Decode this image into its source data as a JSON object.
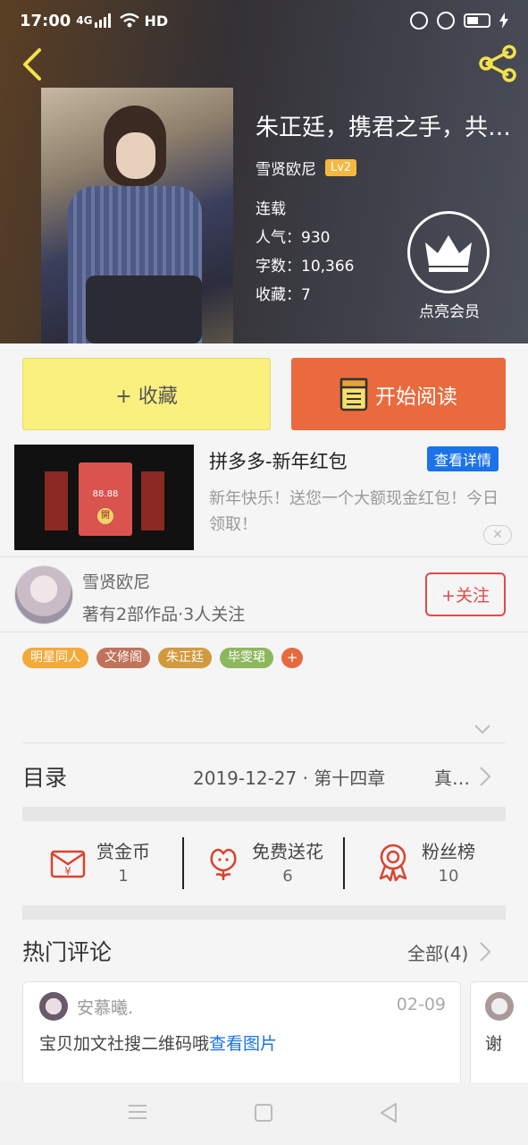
{
  "status_bar": {
    "time": "17:00",
    "network": "4G",
    "quality": "HD"
  },
  "book": {
    "title": "朱正廷，携君之手，共…",
    "author": "雪贤欧尼",
    "level": "Lv2",
    "status": "连载",
    "popularity": "人气：930",
    "word_count": "字数：10,366",
    "favorites": "收藏：7"
  },
  "vip": {
    "label": "点亮会员"
  },
  "actions": {
    "collect": "+ 收藏",
    "read": "开始阅读"
  },
  "ad": {
    "title": "拼多多-新年红包",
    "detail_button": "查看详情",
    "description": "新年快乐！送您一个大额现金红包！今日领取！",
    "thumb_amount": "88.88",
    "thumb_button": "開"
  },
  "author_card": {
    "name": "雪贤欧尼",
    "stats": "著有2部作品·3人关注",
    "follow": "+关注"
  },
  "tags": [
    {
      "label": "明星同人",
      "color": "#f5a93a"
    },
    {
      "label": "文修阁",
      "color": "#c0725a"
    },
    {
      "label": "朱正廷",
      "color": "#d29a3e"
    },
    {
      "label": "毕雯珺",
      "color": "#8bb85c"
    }
  ],
  "tag_more": "+",
  "toc": {
    "label": "目录",
    "date": "2019-12-27 · 第十四章",
    "chapter": "真…"
  },
  "stats": [
    {
      "label": "赏金币",
      "value": "1",
      "icon": "red-envelope-icon"
    },
    {
      "label": "免费送花",
      "value": "6",
      "icon": "flower-icon"
    },
    {
      "label": "粉丝榜",
      "value": "10",
      "icon": "medal-icon"
    }
  ],
  "comments": {
    "label": "热门评论",
    "all": "全部(4)",
    "items": [
      {
        "user": "安慕曦.",
        "date": "02-09",
        "text": "宝贝加文社搜二维码哦",
        "link": "查看图片"
      },
      {
        "text": "谢"
      }
    ]
  },
  "colors": {
    "accent_orange": "#ea6a3d",
    "collect_yellow": "#f9f07e",
    "link_blue": "#1a73e8",
    "follow_red": "#e04a4a"
  }
}
